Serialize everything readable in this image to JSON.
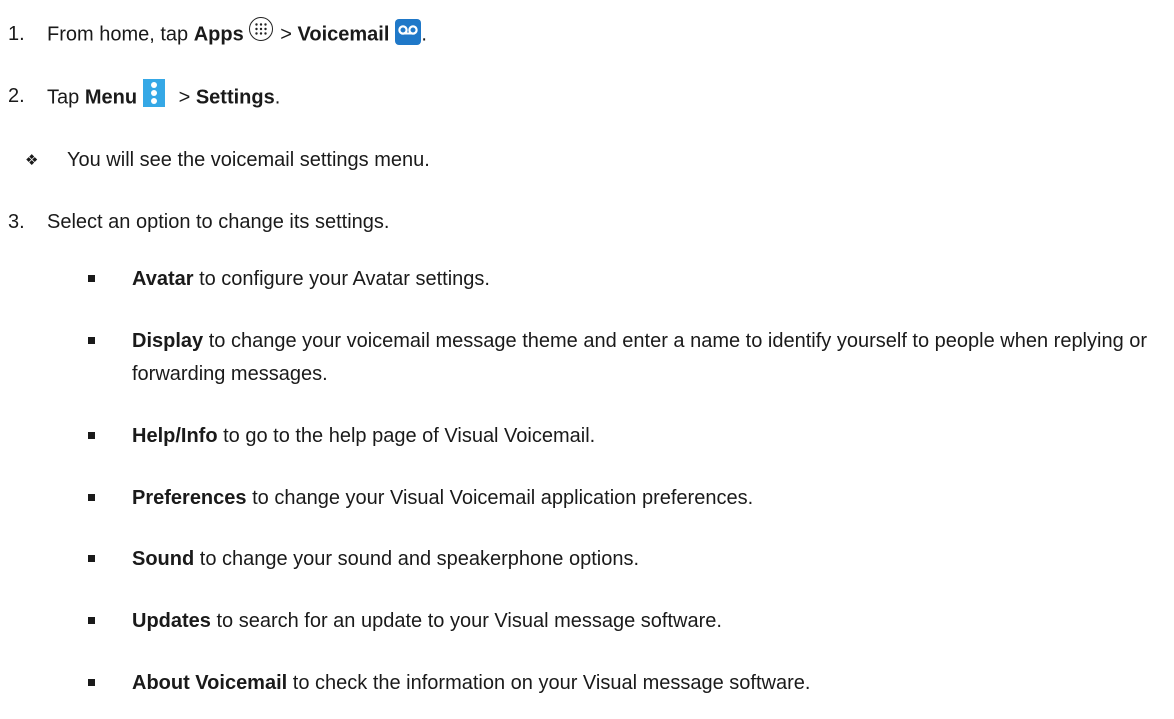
{
  "steps": [
    {
      "num": "1.",
      "text_a": "From home, tap ",
      "bold_a": "Apps",
      "text_b": " > ",
      "bold_b": "Voicemail",
      "text_c": "."
    },
    {
      "num": "2.",
      "text_a": "Tap ",
      "bold_a": "Menu",
      "text_b": " > ",
      "bold_b": "Settings",
      "text_c": "."
    },
    {
      "num": "3.",
      "text": "Select an option to change its settings."
    }
  ],
  "note": {
    "symbol": "❖",
    "text": "You will see the voicemail settings menu."
  },
  "options": [
    {
      "label": "Avatar",
      "desc": " to configure your Avatar settings."
    },
    {
      "label": "Display",
      "desc": " to change your voicemail message theme and enter a name to identify yourself to people when replying or forwarding messages."
    },
    {
      "label": "Help/Info",
      "desc": " to go to the help page of Visual Voicemail."
    },
    {
      "label": "Preferences",
      "desc": " to change your Visual Voicemail application preferences."
    },
    {
      "label": "Sound",
      "desc": " to change your sound and speakerphone options."
    },
    {
      "label": "Updates",
      "desc": " to search for an update to your Visual message software."
    },
    {
      "label": "About Voicemail",
      "desc": " to check the information on your Visual message software."
    }
  ],
  "icons": {
    "apps": "apps-icon",
    "voicemail": "voicemail-icon",
    "menu": "menu-icon"
  },
  "colors": {
    "text": "#1a1a1a",
    "voicemail_icon_bg": "#1f78c8",
    "menu_icon_bg": "#35a8e6"
  }
}
